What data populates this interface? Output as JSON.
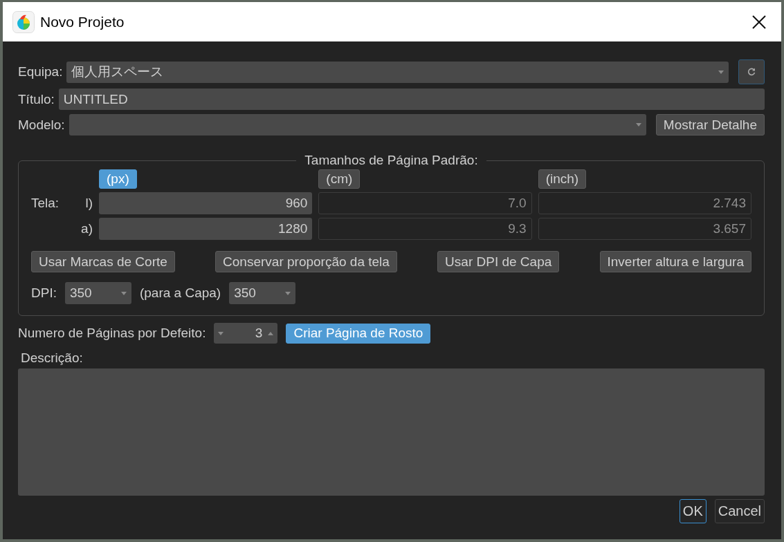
{
  "window": {
    "title": "Novo Projeto"
  },
  "team": {
    "label": "Equipa:",
    "value": "個人用スペース"
  },
  "title_field": {
    "label": "Título:",
    "value": "UNTITLED"
  },
  "template": {
    "label": "Modelo:",
    "button": "Mostrar Detalhe"
  },
  "page_sizes": {
    "legend": "Tamanhos de Página Padrão:",
    "canvas_label": "Tela:",
    "row_labels": [
      "l)",
      "a)"
    ],
    "units": [
      {
        "label": "(px)",
        "selected": true,
        "values": [
          "960",
          "1280"
        ]
      },
      {
        "label": "(cm)",
        "selected": false,
        "values": [
          "7.0",
          "9.3"
        ]
      },
      {
        "label": "(inch)",
        "selected": false,
        "values": [
          "2.743",
          "3.657"
        ]
      }
    ],
    "buttons": [
      "Usar Marcas de Corte",
      "Conservar proporção da tela",
      "Usar DPI de Capa",
      "Inverter altura e largura"
    ],
    "dpi_label": "DPI:",
    "dpi": "350",
    "cover_label": "(para a Capa)",
    "cover_dpi": "350"
  },
  "pages": {
    "label": "Numero de Páginas por Defeito:",
    "value": "3",
    "cover_button": {
      "label": "Criar Página de Rosto",
      "selected": true
    }
  },
  "description": {
    "label": "Descrição:"
  },
  "actions": [
    {
      "label": "OK",
      "default": true
    },
    {
      "label": "Cancel",
      "default": false
    }
  ]
}
